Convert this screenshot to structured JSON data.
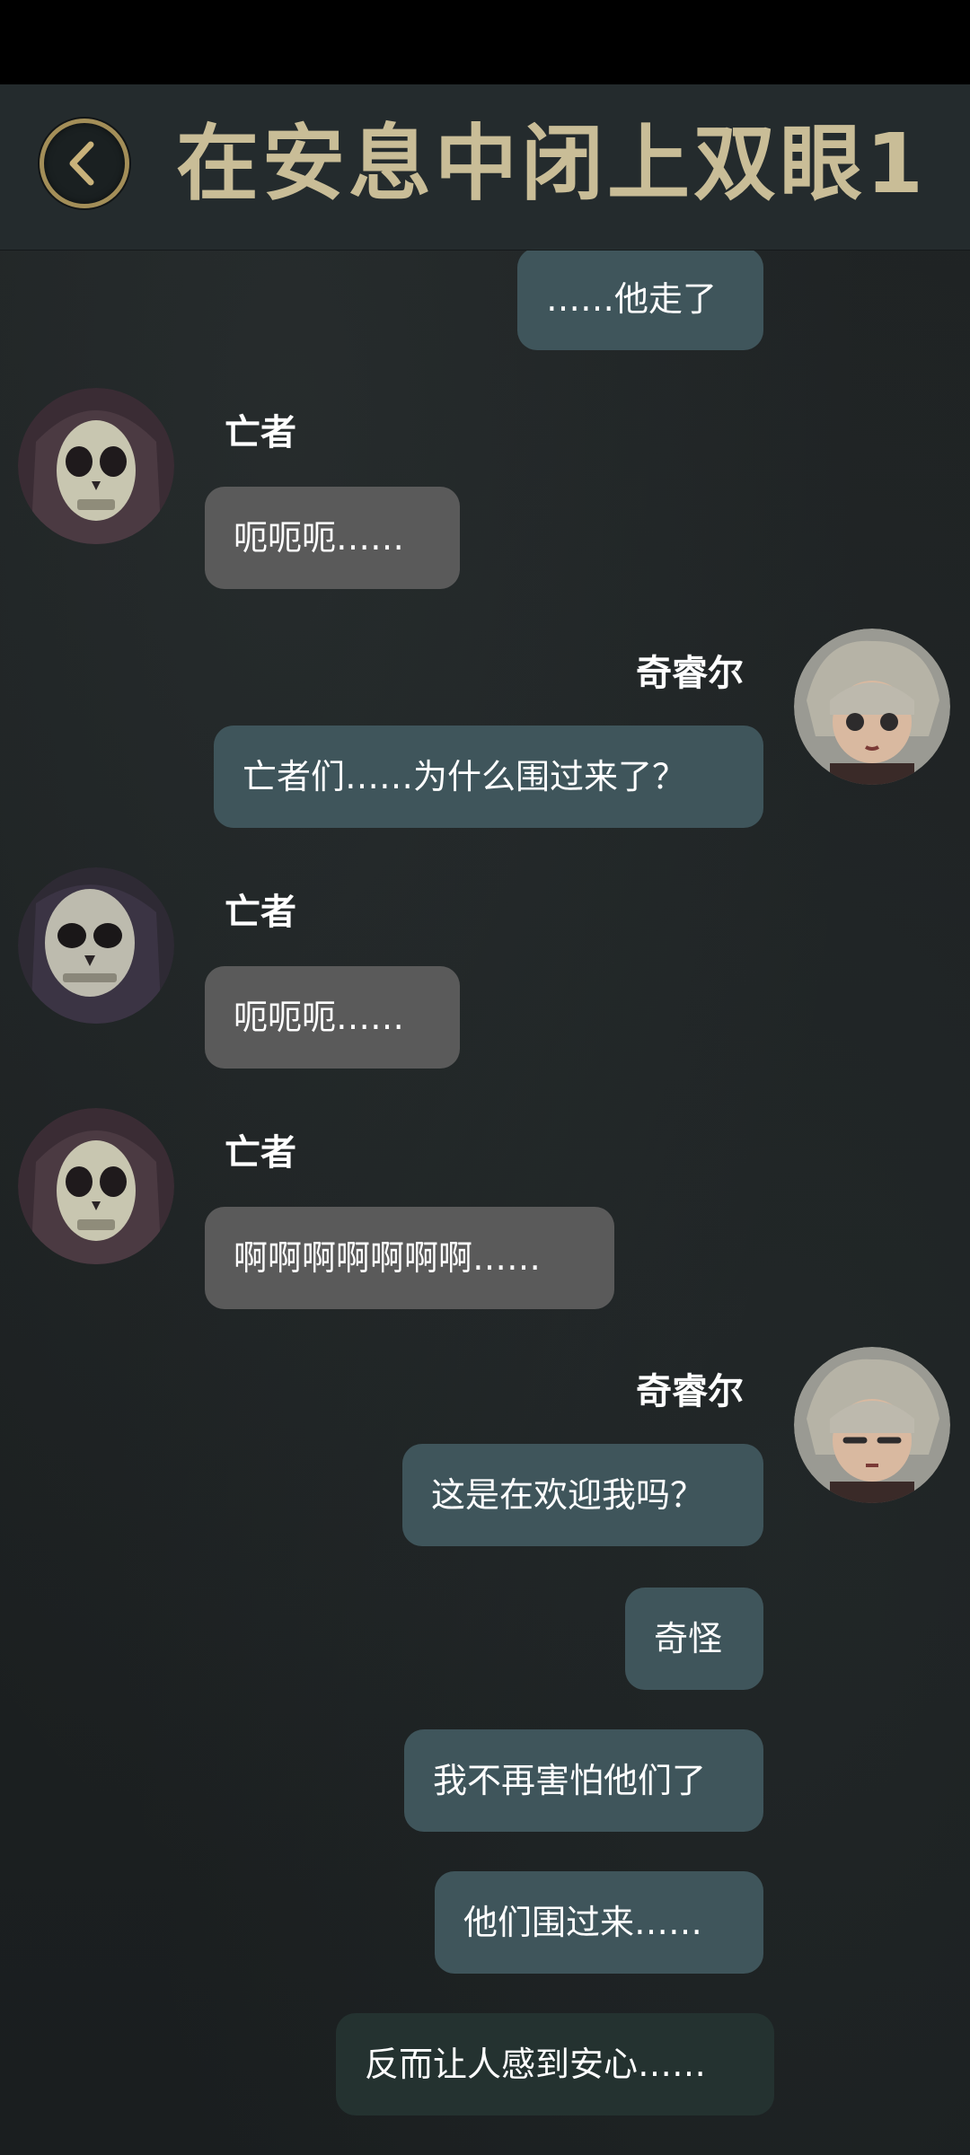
{
  "header": {
    "title": "在安息中闭上双眼1"
  },
  "messages": [
    {
      "side": "right",
      "text": "……他走了"
    },
    {
      "side": "left",
      "speaker": "亡者",
      "text": "呃呃呃……"
    },
    {
      "side": "right",
      "speaker": "奇睿尔",
      "text": "亡者们……为什么围过来了？"
    },
    {
      "side": "left",
      "speaker": "亡者",
      "text": "呃呃呃……"
    },
    {
      "side": "left",
      "speaker": "亡者",
      "text": "啊啊啊啊啊啊啊……"
    },
    {
      "side": "right",
      "speaker": "奇睿尔",
      "text": "这是在欢迎我吗？"
    },
    {
      "side": "right",
      "text": "奇怪"
    },
    {
      "side": "right",
      "text": "我不再害怕他们了"
    },
    {
      "side": "right",
      "text": "他们围过来……"
    },
    {
      "side": "right",
      "text": "反而让人感到安心……"
    }
  ]
}
